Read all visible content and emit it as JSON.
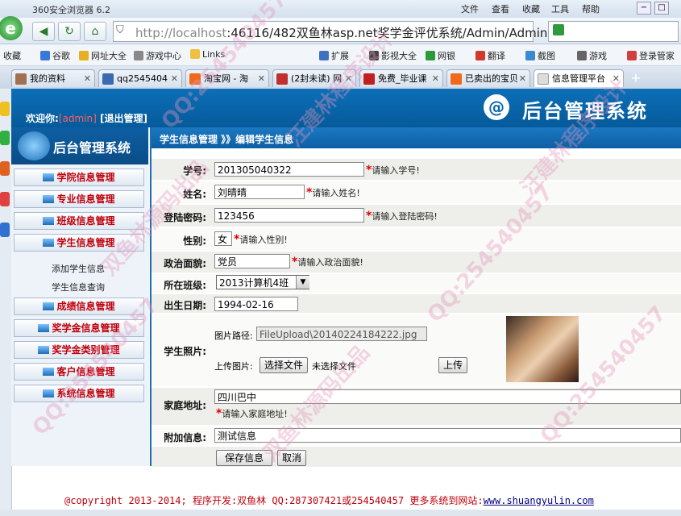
{
  "browser": {
    "title": "360安全浏览器 6.2",
    "menu": [
      "文件",
      "查看",
      "收藏",
      "工具",
      "帮助"
    ],
    "address_host": "http://localhost",
    "address_rest": ":46116/482双鱼林asp.net奖学金评优系统/Admin/Admin"
  },
  "favorites": [
    "收藏",
    "谷歌",
    "网址大全",
    "游戏中心",
    "Links",
    "扩展",
    "影视大全",
    "网银",
    "翻译",
    "截图",
    "游戏",
    "登录管家"
  ],
  "tabs": [
    "我的资料",
    "qq2545404",
    "淘宝网 - 淘",
    "(2封未读) 网",
    "免费_毕业课",
    "已卖出的宝贝",
    "信息管理平台"
  ],
  "header": {
    "welcome": "欢迎你:",
    "user": "[admin]",
    "logout": "[退出管理]",
    "logo_text": "后台管理系统"
  },
  "menu": {
    "logo_text": "后台管理系统",
    "items": [
      "学院信息管理",
      "专业信息管理",
      "班级信息管理",
      "学生信息管理",
      "成绩信息管理",
      "奖学金信息管理",
      "奖学金类别管理",
      "客户信息管理",
      "系统信息管理"
    ],
    "sub_items": [
      "添加学生信息",
      "学生信息查询"
    ]
  },
  "breadcrumb": "学生信息管理 》》编辑学生信息",
  "form": {
    "student_no": {
      "label": "学号:",
      "value": "201305040322",
      "hint": "请输入学号!"
    },
    "name": {
      "label": "姓名:",
      "value": "刘晴晴",
      "hint": "请输入姓名!"
    },
    "password": {
      "label": "登陆密码:",
      "value": "123456",
      "hint": "请输入登陆密码!"
    },
    "sex": {
      "label": "性别:",
      "value": "女",
      "hint": "请输入性别!"
    },
    "politics": {
      "label": "政治面貌:",
      "value": "党员",
      "hint": "请输入政治面貌!"
    },
    "class": {
      "label": "所在班级:",
      "value": "2013计算机4班"
    },
    "birthday": {
      "label": "出生日期:",
      "value": "1994-02-16"
    },
    "photo": {
      "label": "学生照片:",
      "path_label": "图片路径:",
      "path_value": "FileUpload\\20140224184222.jpg",
      "upload_label": "上传图片:",
      "choose_button": "选择文件",
      "no_file": "未选择文件",
      "upload_button": "上传"
    },
    "address": {
      "label": "家庭地址:",
      "value": "四川巴中",
      "hint": "请输入家庭地址!"
    },
    "extra": {
      "label": "附加信息:",
      "value": "测试信息"
    },
    "save_button": "保存信息",
    "cancel_button": "取消"
  },
  "footer": {
    "text": "@copyright 2013-2014; 程序开发:双鱼林  QQ:287307421或254540457  更多系统到网站:",
    "link": "www.shuangyulin.com"
  },
  "watermarks": [
    "QQ:254540457",
    "汪建林程序设计",
    "双鱼林源码出品"
  ]
}
